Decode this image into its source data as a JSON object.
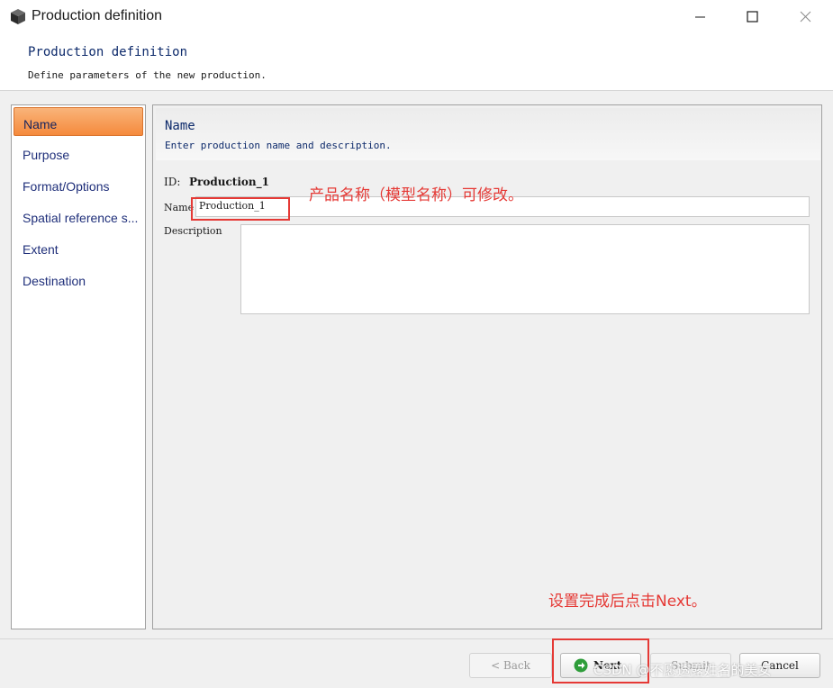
{
  "window": {
    "title": "Production definition",
    "icon": "package-cube-icon"
  },
  "header": {
    "title": "Production definition",
    "description": "Define parameters of the new production."
  },
  "sidebar": {
    "items": [
      {
        "label": "Name",
        "active": true
      },
      {
        "label": "Purpose",
        "active": false
      },
      {
        "label": "Format/Options",
        "active": false
      },
      {
        "label": "Spatial reference s...",
        "active": false
      },
      {
        "label": "Extent",
        "active": false
      },
      {
        "label": "Destination",
        "active": false
      }
    ]
  },
  "section": {
    "title": "Name",
    "description": "Enter production name and description."
  },
  "form": {
    "id_label": "ID:",
    "id_value": "Production_1",
    "name_label": "Name",
    "name_value": "Production_1",
    "description_label": "Description",
    "description_value": ""
  },
  "annotations": {
    "name_note": "产品名称（模型名称）可修改。",
    "next_note": "设置完成后点击Next。",
    "color": "#e53935"
  },
  "footer": {
    "back_label": "< Back",
    "next_label": "Next",
    "submit_label": "Submit",
    "cancel_label": "Cancel"
  },
  "watermark": "CSDN @不愿透露姓名的美女",
  "colors": {
    "active_item": "#f58a3c",
    "heading_text": "#0d2a6b",
    "next_icon": "#2e9d3a"
  }
}
